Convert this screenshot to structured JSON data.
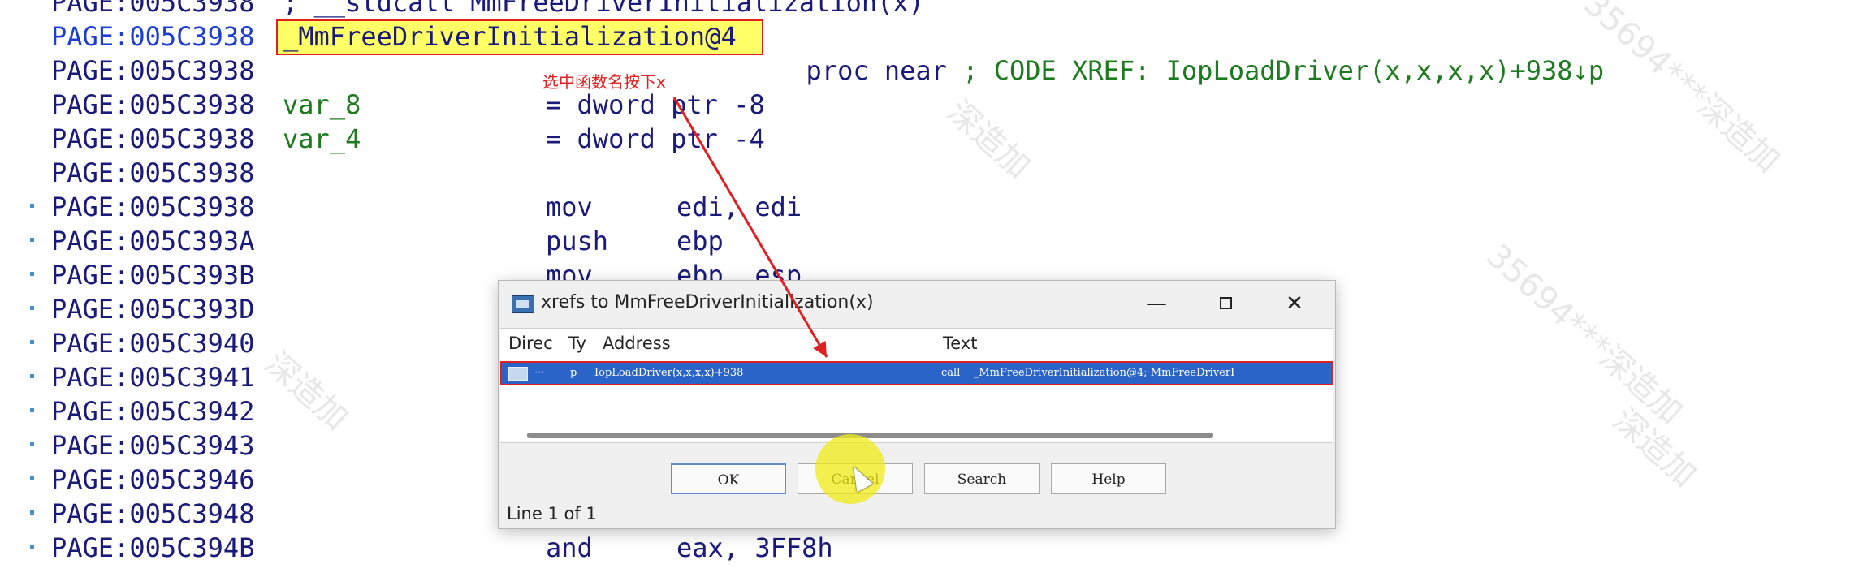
{
  "code": {
    "lines": [
      {
        "addr": "PAGE:005C3938",
        "dot": false,
        "col2": "; __stdcall MmFreeDriverInitialization(x)",
        "col2_class": "navy",
        "col3": "",
        "col4": ""
      },
      {
        "addr": "PAGE:005C3938",
        "dot": false,
        "col2": "",
        "col2_class": "",
        "col3": "",
        "col4": ""
      },
      {
        "addr": "PAGE:005C3938",
        "dot": false,
        "col2": "",
        "col2_class": "",
        "col3": "",
        "col4": ""
      },
      {
        "addr": "PAGE:005C3938",
        "dot": false,
        "col2": "var_8",
        "col2_class": "green",
        "col3": "= dword ptr -8",
        "col4": ""
      },
      {
        "addr": "PAGE:005C3938",
        "dot": false,
        "col2": "var_4",
        "col2_class": "green",
        "col3": "= dword ptr -4",
        "col4": ""
      },
      {
        "addr": "PAGE:005C3938",
        "dot": false,
        "col2": "",
        "col2_class": "",
        "col3": "",
        "col4": ""
      },
      {
        "addr": "PAGE:005C3938",
        "dot": true,
        "col2": "",
        "col2_class": "",
        "col3": "mov",
        "col4": "edi, edi"
      },
      {
        "addr": "PAGE:005C393A",
        "dot": true,
        "col2": "",
        "col2_class": "",
        "col3": "push",
        "col4": "ebp"
      },
      {
        "addr": "PAGE:005C393B",
        "dot": true,
        "col2": "",
        "col2_class": "",
        "col3": "mov",
        "col4": "ebp, esp"
      },
      {
        "addr": "PAGE:005C393D",
        "dot": true,
        "col2": "",
        "col2_class": "",
        "col3": "",
        "col4": ""
      },
      {
        "addr": "PAGE:005C3940",
        "dot": true,
        "col2": "",
        "col2_class": "",
        "col3": "",
        "col4": ""
      },
      {
        "addr": "PAGE:005C3941",
        "dot": true,
        "col2": "",
        "col2_class": "",
        "col3": "",
        "col4": ""
      },
      {
        "addr": "PAGE:005C3942",
        "dot": true,
        "col2": "",
        "col2_class": "",
        "col3": "",
        "col4": ""
      },
      {
        "addr": "PAGE:005C3943",
        "dot": true,
        "col2": "",
        "col2_class": "",
        "col3": "",
        "col4": ""
      },
      {
        "addr": "PAGE:005C3946",
        "dot": true,
        "col2": "",
        "col2_class": "",
        "col3": "",
        "col4": ""
      },
      {
        "addr": "PAGE:005C3948",
        "dot": true,
        "col2": "",
        "col2_class": "",
        "col3": "",
        "col4": ""
      },
      {
        "addr": "PAGE:005C394B",
        "dot": true,
        "col2": "",
        "col2_class": "",
        "col3": "and",
        "col4": "eax, 3FF8h"
      }
    ],
    "func_line_addr": "PAGE:005C3938",
    "func_name": "_MmFreeDriverInitialization@4",
    "proc_keyword": "proc near",
    "xref_comment": "; CODE XREF: IopLoadDriver(x,x,x,x)+938↓p"
  },
  "annotation": "选中函数名按下x",
  "watermarks": [
    "35694***深造加",
    "深造加",
    "35694***",
    "35694***深造加",
    "深造加"
  ],
  "dialog": {
    "title": "xrefs to MmFreeDriverInitialization(x)",
    "columns": {
      "direction": "Direc",
      "type": "Ty",
      "address": "Address",
      "text": "Text"
    },
    "rows": [
      {
        "direction": "···",
        "type": "p",
        "address": "IopLoadDriver(x,x,x,x)+938",
        "text": "call    _MmFreeDriverInitialization@4; MmFreeDriverI"
      }
    ],
    "buttons": {
      "ok": "OK",
      "cancel": "Cancel",
      "search": "Search",
      "help": "Help"
    },
    "status": "Line 1 of 1"
  },
  "colors": {
    "highlight": "#ffff66",
    "outline": "#e02020",
    "selection": "#2a64c8"
  }
}
